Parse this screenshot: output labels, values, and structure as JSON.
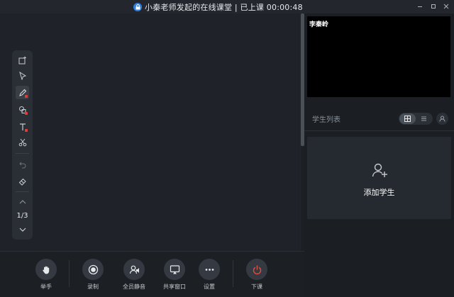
{
  "titlebar": {
    "title": "小秦老师发起的在线课堂 | 已上课 00:00:48",
    "lock_icon": "lock-icon",
    "controls": [
      "minimize-icon",
      "maximize-icon",
      "close-icon"
    ]
  },
  "whiteboard": {
    "page_indicator": "1/3",
    "tools": [
      "add-page-icon",
      "select-arrow-icon",
      "pen-icon",
      "shape-icon",
      "text-icon",
      "scissors-icon",
      "undo-icon",
      "eraser-icon",
      "chevron-up-icon",
      "chevron-down-icon"
    ],
    "active_tool": "pen-icon"
  },
  "bottombar": {
    "buttons": [
      {
        "label": "举手",
        "icon": "hand-icon"
      },
      {
        "label": "录制",
        "icon": "record-icon"
      },
      {
        "label": "全员静音",
        "icon": "mute-all-icon"
      },
      {
        "label": "共享窗口",
        "icon": "screen-share-icon"
      },
      {
        "label": "设置",
        "icon": "more-dots-icon"
      },
      {
        "label": "下课",
        "icon": "power-icon"
      }
    ]
  },
  "rightpanel": {
    "video_name": "李秦岭",
    "student_list_title": "学生列表",
    "add_student_label": "添加学生"
  },
  "colors": {
    "accent_blue": "#2f7fe0",
    "end_class_red": "#e34a3a",
    "tool_dot_red": "#e23c3c"
  }
}
